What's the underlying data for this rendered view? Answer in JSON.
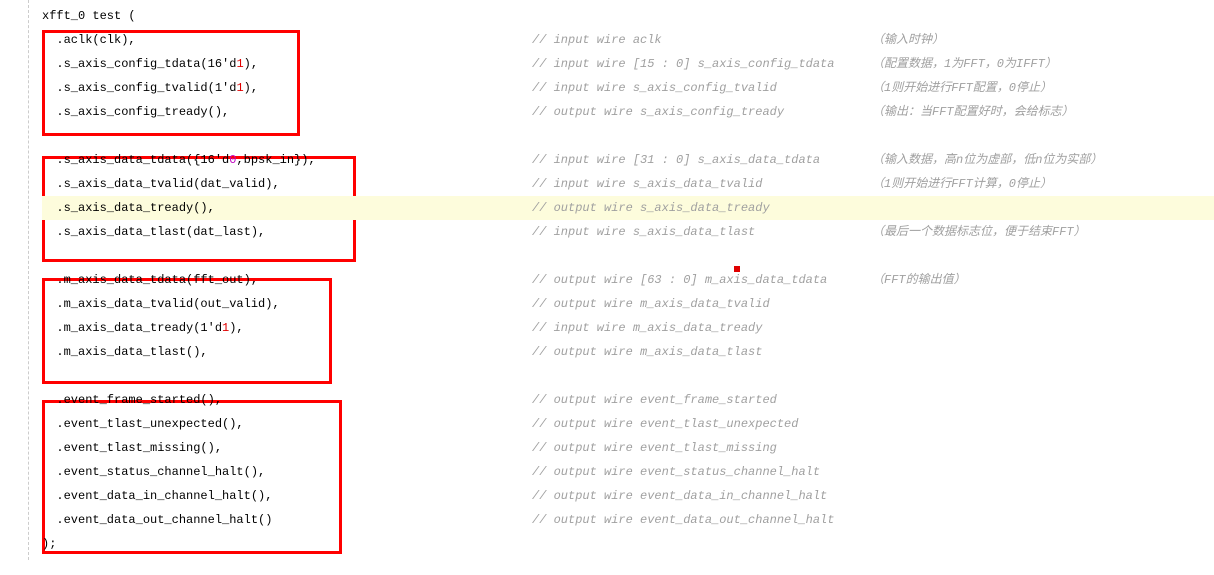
{
  "header": "xfft_0 test (",
  "closer": ");",
  "groups": [
    {
      "lines": [
        {
          "port": ".aclk(clk),",
          "comment": "// input wire aclk",
          "note": "（输入时钟）"
        },
        {
          "port_pre": ".s_axis_config_tdata(16'd",
          "num": "1",
          "numcls": "red",
          "port_post": "),",
          "comment": "// input wire [15 : 0] s_axis_config_tdata",
          "note": "（配置数据，1为FFT，0为IFFT）"
        },
        {
          "port_pre": ".s_axis_config_tvalid(1'd",
          "num": "1",
          "numcls": "red",
          "port_post": "),",
          "comment": "// input wire s_axis_config_tvalid",
          "note": "（1则开始进行FFT配置，0停止）"
        },
        {
          "port": ".s_axis_config_tready(),",
          "comment": "// output wire s_axis_config_tready",
          "note": "（输出：当FFT配置好时，会给标志）"
        }
      ]
    },
    {
      "lines": [
        {
          "port_pre": ".s_axis_data_tdata({16'd",
          "num": "0",
          "numcls": "mag",
          "port_post": ",bpsk_in}),",
          "comment": "// input wire [31 : 0] s_axis_data_tdata",
          "note": "（输入数据，高n位为虚部，低n位为实部）"
        },
        {
          "port": ".s_axis_data_tvalid(dat_valid),",
          "comment": "// input wire s_axis_data_tvalid",
          "note": "（1则开始进行FFT计算，0停止）"
        },
        {
          "port": ".s_axis_data_tready(),",
          "comment": "// output wire s_axis_data_tready",
          "note": "",
          "hl": true
        },
        {
          "port": ".s_axis_data_tlast(dat_last),",
          "comment": "// input wire s_axis_data_tlast",
          "note": "（最后一个数据标志位，便于结束FFT）"
        }
      ]
    },
    {
      "lines": [
        {
          "port": ".m_axis_data_tdata(fft_out),",
          "comment": "// output wire [63 : 0] m_axis_data_tdata",
          "note": "（FFT的输出值）",
          "cursor_after_comment": true
        },
        {
          "port": ".m_axis_data_tvalid(out_valid),",
          "comment": "// output wire m_axis_data_tvalid",
          "note": ""
        },
        {
          "port_pre": ".m_axis_data_tready(1'd",
          "num": "1",
          "numcls": "red",
          "port_post": "),",
          "comment": "// input wire m_axis_data_tready",
          "note": ""
        },
        {
          "port": ".m_axis_data_tlast(),",
          "comment": "// output wire m_axis_data_tlast",
          "note": ""
        }
      ]
    },
    {
      "lines": [
        {
          "port": ".event_frame_started(),",
          "comment": "// output wire event_frame_started",
          "note": ""
        },
        {
          "port": ".event_tlast_unexpected(),",
          "comment": "// output wire event_tlast_unexpected",
          "note": ""
        },
        {
          "port": ".event_tlast_missing(),",
          "comment": "// output wire event_tlast_missing",
          "note": ""
        },
        {
          "port": ".event_status_channel_halt(),",
          "comment": "// output wire event_status_channel_halt",
          "note": ""
        },
        {
          "port": ".event_data_in_channel_halt(),",
          "comment": "// output wire event_data_in_channel_halt",
          "note": ""
        },
        {
          "port": ".event_data_out_channel_halt()",
          "comment": "// output wire event_data_out_channel_halt",
          "note": ""
        }
      ]
    }
  ]
}
